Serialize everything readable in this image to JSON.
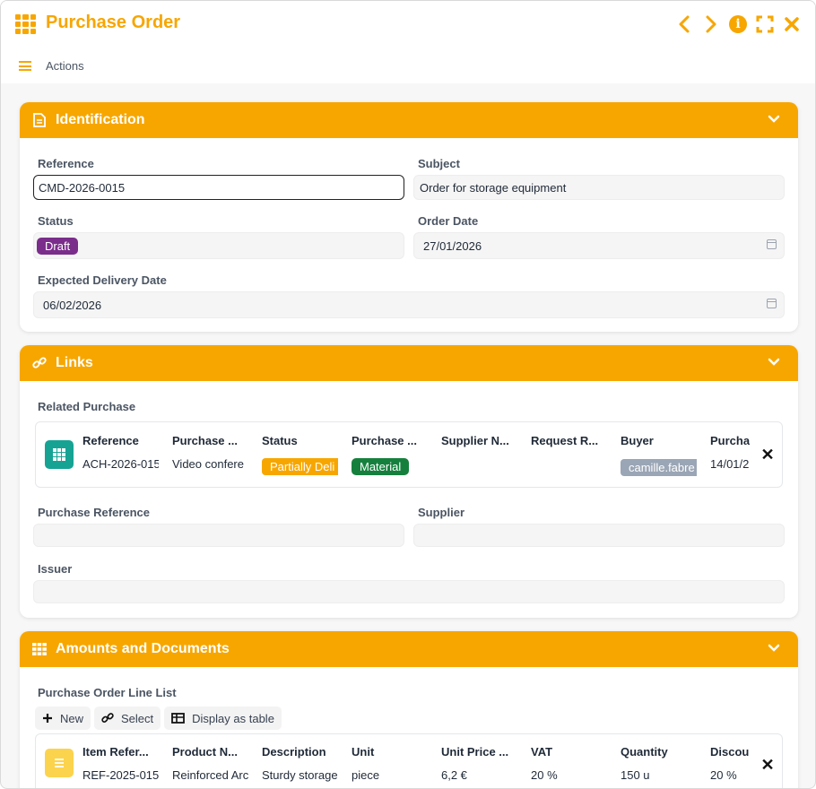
{
  "window": {
    "title": "Purchase Order"
  },
  "toolbar": {
    "actions_label": "Actions"
  },
  "identification": {
    "title": "Identification",
    "reference_label": "Reference",
    "reference_value": "CMD-2026-0015",
    "subject_label": "Subject",
    "subject_value": "Order for storage equipment",
    "status_label": "Status",
    "status_value": "Draft",
    "status_color": "#7b2d8b",
    "order_date_label": "Order Date",
    "order_date_value": "27/01/2026",
    "delivery_label": "Expected Delivery Date",
    "delivery_value": "06/02/2026"
  },
  "links": {
    "title": "Links",
    "related_label": "Related Purchase",
    "columns": [
      "Reference",
      "Purchase ...",
      "Status",
      "Purchase ...",
      "Supplier N...",
      "Request R...",
      "Buyer",
      "Purcha"
    ],
    "row": {
      "reference": "ACH-2026-015",
      "purchase": "Video confere",
      "status": "Partially Deli",
      "status_color": "#f7a600",
      "type": "Material",
      "type_color": "#15803d",
      "supplier": "",
      "request": "",
      "buyer": "camille.fabre",
      "buyer_color": "#9aa5b5",
      "date": "14/01/2"
    },
    "purchase_ref_label": "Purchase Reference",
    "supplier_label": "Supplier",
    "issuer_label": "Issuer"
  },
  "amounts": {
    "title": "Amounts and Documents",
    "list_label": "Purchase Order Line List",
    "btn_new": "New",
    "btn_select": "Select",
    "btn_table": "Display as table",
    "columns": [
      "Item Refer...",
      "Product N...",
      "Description",
      "Unit",
      "Unit Price ...",
      "VAT",
      "Quantity",
      "Discou"
    ],
    "row": [
      "REF-2025-015",
      "Reinforced Arc",
      "Sturdy storage",
      "piece",
      "6,2 €",
      "20 %",
      "150 u",
      "20 %"
    ]
  },
  "colors": {
    "accent": "#f7a600",
    "teal": "#16a394",
    "yellow_icon": "#fcd34d"
  }
}
